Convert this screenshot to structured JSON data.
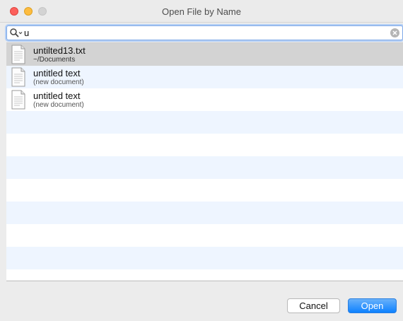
{
  "window": {
    "title": "Open File by Name"
  },
  "search": {
    "value": "u"
  },
  "files": [
    {
      "name": "untilted13.txt",
      "path": "~/Documents"
    },
    {
      "name": "untitled text",
      "path": "(new document)"
    },
    {
      "name": "untitled text",
      "path": "(new document)"
    }
  ],
  "buttons": {
    "cancel": "Cancel",
    "open": "Open"
  },
  "colors": {
    "accent": "#0d81ff",
    "selected_row": "#d3d3d3",
    "alt_row": "#eef5ff",
    "focus_ring": "#b4cff5"
  }
}
